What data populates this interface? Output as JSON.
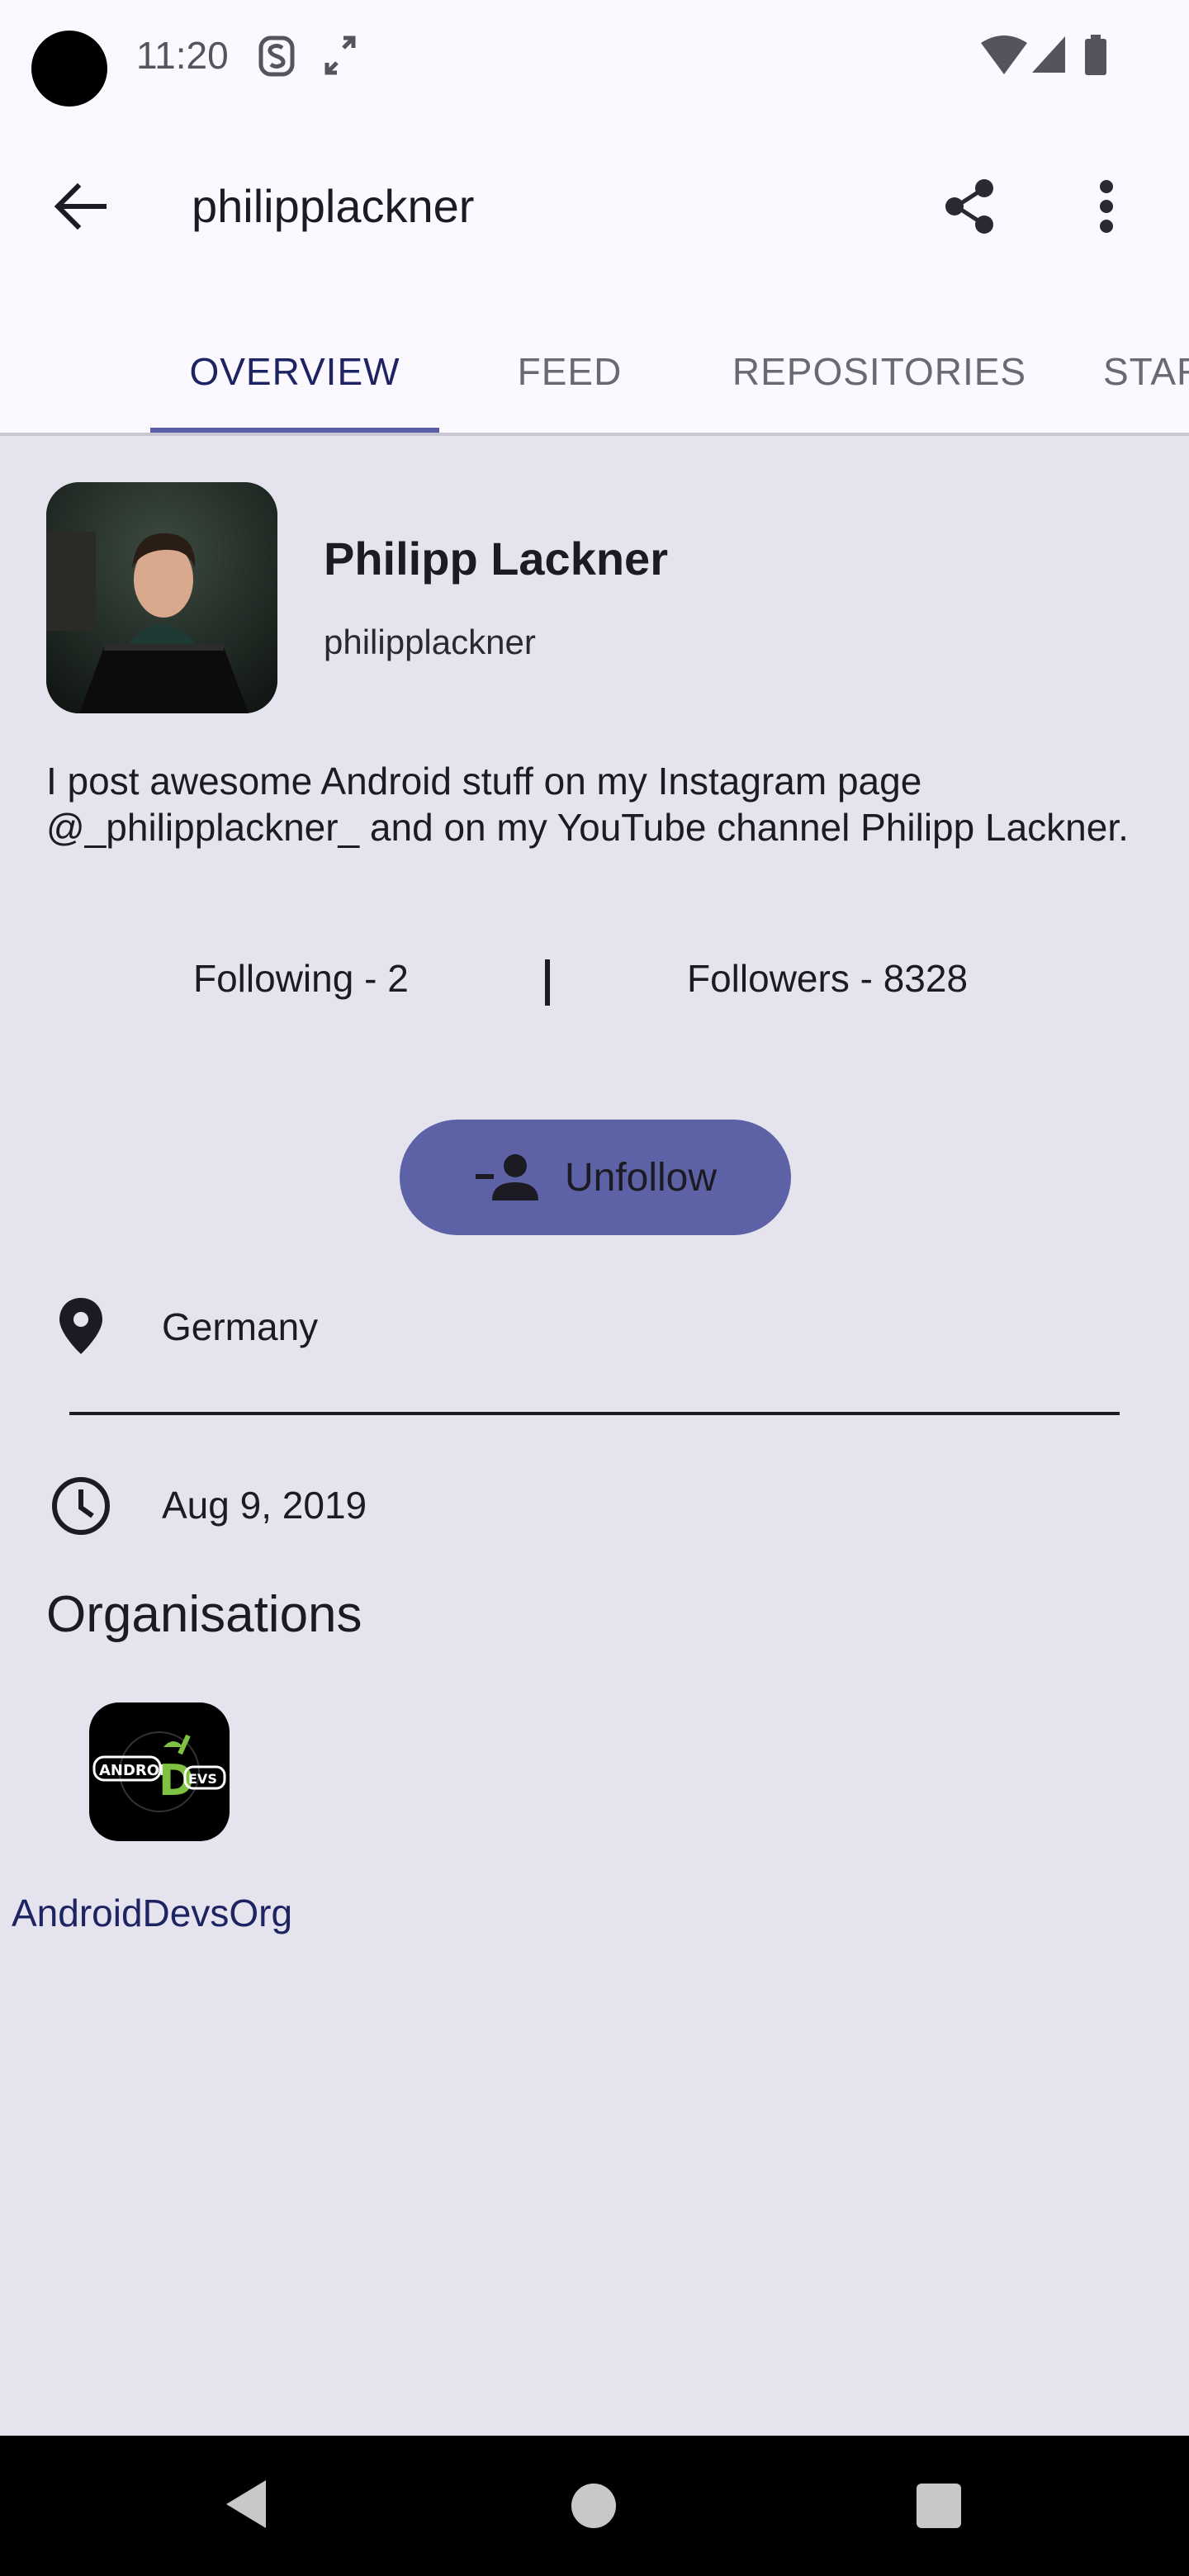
{
  "status_bar": {
    "time": "11:20",
    "icons": [
      "s-notification-icon",
      "expand-arrows-icon",
      "wifi-icon",
      "signal-icon",
      "battery-icon"
    ]
  },
  "app_bar": {
    "title": "philipplackner",
    "back_icon": "arrow-back-icon",
    "share_icon": "share-icon",
    "more_icon": "more-vert-icon"
  },
  "tabs": [
    {
      "label": "OVERVIEW",
      "active": true
    },
    {
      "label": "FEED",
      "active": false
    },
    {
      "label": "REPOSITORIES",
      "active": false
    },
    {
      "label": "STAR",
      "active": false
    }
  ],
  "profile": {
    "name": "Philipp Lackner",
    "login": "philipplackner",
    "bio": "I post awesome Android stuff on my Instagram page @_philipplackner_ and on my YouTube channel Philipp Lackner.",
    "following": "Following - 2",
    "followers": "Followers - 8328",
    "action_button": "Unfollow",
    "location": "Germany",
    "joined": "Aug 9, 2019"
  },
  "organisations": {
    "title": "Organisations",
    "items": [
      {
        "name": "AndroidDevsOrg",
        "logo_text_left": "ANDROI",
        "logo_text_d": "D",
        "logo_text_right": "EVS"
      }
    ]
  },
  "colors": {
    "accent": "#5d62a6",
    "background": "#e5e4ee",
    "surface": "#fbf9ff",
    "active_tab": "#1e2361"
  }
}
